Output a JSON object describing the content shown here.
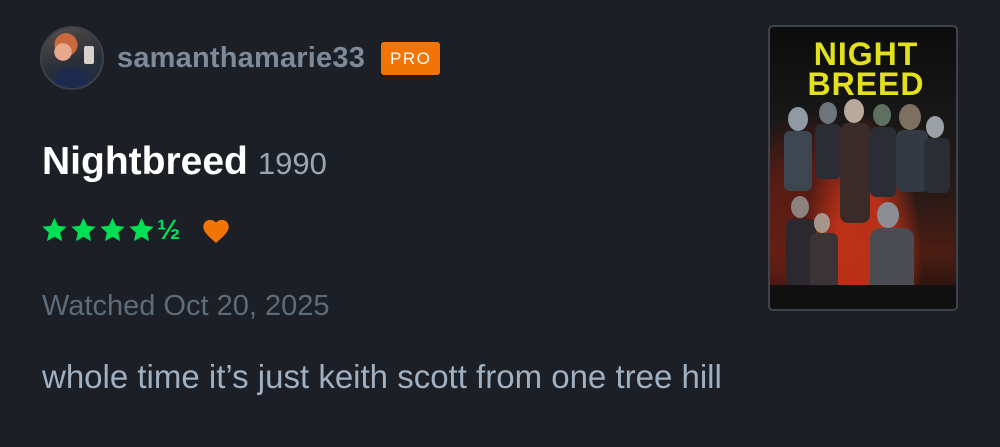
{
  "user": {
    "username": "samanthamarie33",
    "badge": "PRO"
  },
  "film": {
    "title": "Nightbreed",
    "year": "1990",
    "rating_stars": 4.5,
    "rating_half_glyph": "½",
    "liked": true,
    "poster_title": "NIGHT BREED"
  },
  "watched": "Watched Oct 20, 2025",
  "review": "whole time it’s just keith scott from one tree hill",
  "colors": {
    "background": "#1c1f26",
    "star": "#00e054",
    "heart": "#f27405",
    "badge": "#f27405",
    "username": "#7d8a99",
    "review": "#9fb0c2"
  },
  "icons": {
    "star": "star-icon",
    "heart": "heart-icon"
  }
}
